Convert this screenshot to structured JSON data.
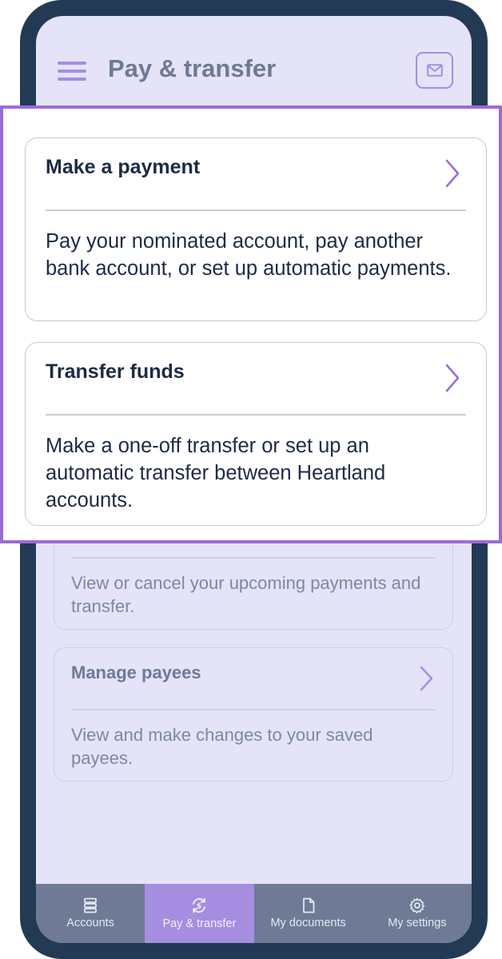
{
  "header": {
    "title": "Pay & transfer",
    "menu_icon": "hamburger-menu-icon",
    "mail_icon": "mail-icon"
  },
  "highlighted_cards": [
    {
      "title": "Make a payment",
      "description": "Pay your nominated account, pay another bank account, or set up automatic payments."
    },
    {
      "title": "Transfer funds",
      "description": "Make a one-off transfer or set up an automatic transfer between Heartland accounts."
    }
  ],
  "background_cards": [
    {
      "title": "",
      "description": "View or cancel your upcoming payments and transfer."
    },
    {
      "title": "Manage payees",
      "description": "View and make changes to your saved payees."
    }
  ],
  "bottom_nav": [
    {
      "label": "Accounts",
      "icon": "accounts-icon",
      "active": false
    },
    {
      "label": "Pay & transfer",
      "icon": "pay-transfer-icon",
      "active": true
    },
    {
      "label": "My documents",
      "icon": "document-icon",
      "active": false
    },
    {
      "label": "My settings",
      "icon": "gear-icon",
      "active": false
    }
  ],
  "colors": {
    "accent": "#a58ee0",
    "highlight_border": "#9b6bd6",
    "frame": "#233a55",
    "screen_bg": "#e4e3f7",
    "nav_bg": "#6e7a96",
    "text_dark": "#1c2b45"
  }
}
